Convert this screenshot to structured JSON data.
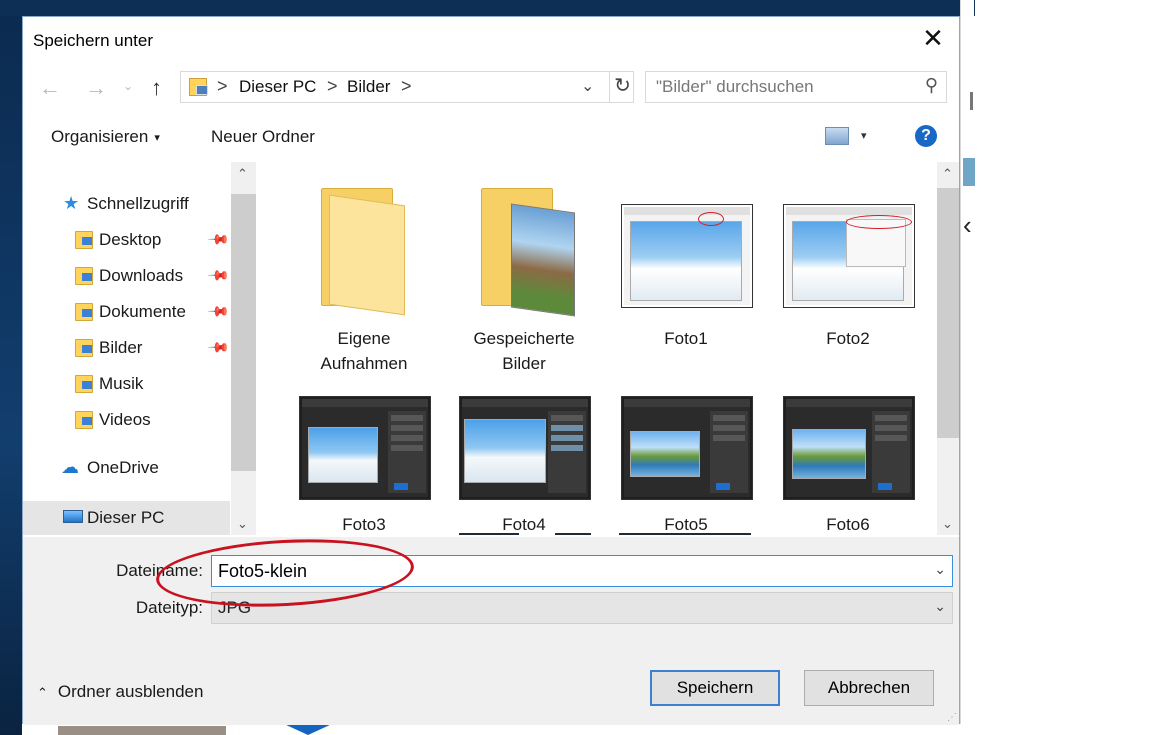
{
  "dialog": {
    "title": "Speichern unter",
    "close_glyph": "✕"
  },
  "nav": {
    "back_glyph": "←",
    "forward_glyph": "→",
    "recent_glyph": "⌄",
    "up_glyph": "↑"
  },
  "address": {
    "sep": ">",
    "crumbs": [
      "Dieser PC",
      "Bilder"
    ],
    "drop_glyph": "⌄",
    "refresh_glyph": "↻"
  },
  "search": {
    "placeholder": "\"Bilder\" durchsuchen",
    "icon": "search-icon"
  },
  "toolbar": {
    "organize_label": "Organisieren",
    "new_folder_label": "Neuer Ordner",
    "caret": "▾",
    "help_label": "?"
  },
  "sidebar": {
    "items": [
      {
        "label": "Schnellzugriff",
        "icon": "star-icon"
      },
      {
        "label": "Desktop",
        "icon": "folder-icon",
        "pinned": true
      },
      {
        "label": "Downloads",
        "icon": "folder-icon",
        "pinned": true
      },
      {
        "label": "Dokumente",
        "icon": "folder-icon",
        "pinned": true
      },
      {
        "label": "Bilder",
        "icon": "folder-icon",
        "pinned": true
      },
      {
        "label": "Musik",
        "icon": "folder-icon"
      },
      {
        "label": "Videos",
        "icon": "folder-icon"
      },
      {
        "label": "OneDrive",
        "icon": "cloud-icon"
      },
      {
        "label": "Dieser PC",
        "icon": "pc-icon",
        "selected": true
      }
    ],
    "pin_glyph": "📌",
    "star_glyph": "★",
    "cloud_glyph": "☁"
  },
  "files": [
    {
      "name_line1": "Eigene",
      "name_line2": "Aufnahmen",
      "type": "folder"
    },
    {
      "name_line1": "Gespeicherte",
      "name_line2": "Bilder",
      "type": "folder"
    },
    {
      "name": "Foto1",
      "type": "image"
    },
    {
      "name": "Foto2",
      "type": "image"
    },
    {
      "name": "Foto3",
      "type": "image"
    },
    {
      "name": "Foto4",
      "type": "image"
    },
    {
      "name": "Foto5",
      "type": "image"
    },
    {
      "name": "Foto6",
      "type": "image"
    }
  ],
  "scroll": {
    "up": "⌃",
    "down": "⌄"
  },
  "form": {
    "filename_label": "Dateiname:",
    "filename_value": "Foto5-klein",
    "filetype_label": "Dateityp:",
    "filetype_value": "JPG",
    "dd_glyph": "⌄"
  },
  "footer": {
    "hide_folders_label": "Ordner ausblenden",
    "hide_chevron": "⌃",
    "save_label": "Speichern",
    "cancel_label": "Abbrechen"
  },
  "colors": {
    "accent": "#3d7fd1",
    "annotation_red": "#c8121f",
    "folder_yellow": "#f6cf65"
  }
}
